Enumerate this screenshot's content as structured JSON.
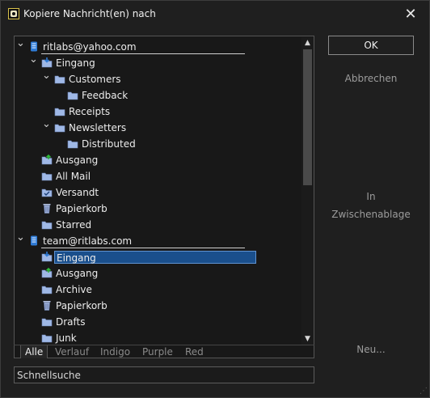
{
  "window": {
    "title": "Kopiere Nachricht(en) nach",
    "close": "✕"
  },
  "tree": [
    {
      "label": "ritlabs@yahoo.com",
      "icon": "account",
      "depth": 0,
      "expander": "down",
      "name": "account-ritlabs"
    },
    {
      "label": "Eingang",
      "icon": "inbox",
      "depth": 1,
      "expander": "down",
      "name": "folder-eingang"
    },
    {
      "label": "Customers",
      "icon": "folder",
      "depth": 2,
      "expander": "down",
      "name": "folder-customers"
    },
    {
      "label": "Feedback",
      "icon": "folder",
      "depth": 3,
      "expander": "",
      "name": "folder-feedback"
    },
    {
      "label": "Receipts",
      "icon": "folder",
      "depth": 2,
      "expander": "",
      "name": "folder-receipts"
    },
    {
      "label": "Newsletters",
      "icon": "folder",
      "depth": 2,
      "expander": "down",
      "name": "folder-newsletters"
    },
    {
      "label": "Distributed",
      "icon": "folder",
      "depth": 3,
      "expander": "",
      "name": "folder-distributed"
    },
    {
      "label": "Ausgang",
      "icon": "outbox",
      "depth": 1,
      "expander": "",
      "name": "folder-ausgang"
    },
    {
      "label": "All Mail",
      "icon": "folder",
      "depth": 1,
      "expander": "",
      "name": "folder-all-mail"
    },
    {
      "label": "Versandt",
      "icon": "sent",
      "depth": 1,
      "expander": "",
      "name": "folder-versandt"
    },
    {
      "label": "Papierkorb",
      "icon": "trash",
      "depth": 1,
      "expander": "",
      "name": "folder-papierkorb"
    },
    {
      "label": "Starred",
      "icon": "folder",
      "depth": 1,
      "expander": "",
      "name": "folder-starred"
    },
    {
      "label": "team@ritlabs.com",
      "icon": "account",
      "depth": 0,
      "expander": "down",
      "name": "account-team"
    },
    {
      "label": "Eingang",
      "icon": "inbox",
      "depth": 1,
      "expander": "",
      "name": "folder-team-eingang",
      "selected": true
    },
    {
      "label": "Ausgang",
      "icon": "outbox",
      "depth": 1,
      "expander": "",
      "name": "folder-team-ausgang"
    },
    {
      "label": "Archive",
      "icon": "folder",
      "depth": 1,
      "expander": "",
      "name": "folder-team-archive"
    },
    {
      "label": "Papierkorb",
      "icon": "trash",
      "depth": 1,
      "expander": "",
      "name": "folder-team-papierkorb"
    },
    {
      "label": "Drafts",
      "icon": "folder",
      "depth": 1,
      "expander": "",
      "name": "folder-team-drafts"
    },
    {
      "label": "Junk",
      "icon": "folder",
      "depth": 1,
      "expander": "",
      "name": "folder-team-junk"
    }
  ],
  "tabs": [
    "Alle",
    "Verlauf",
    "Indigo",
    "Purple",
    "Red"
  ],
  "active_tab": "Alle",
  "search": {
    "value": "Schnellsuche"
  },
  "buttons": {
    "ok": "OK",
    "cancel": "Abbrechen",
    "clipboard": "In Zwischenablage",
    "new": "Neu..."
  },
  "colors": {
    "selection": "#1a4f8c",
    "folder": "#9fb8e6",
    "account": "#2f7bd6",
    "outbox_arrow": "#2dbb3a"
  }
}
